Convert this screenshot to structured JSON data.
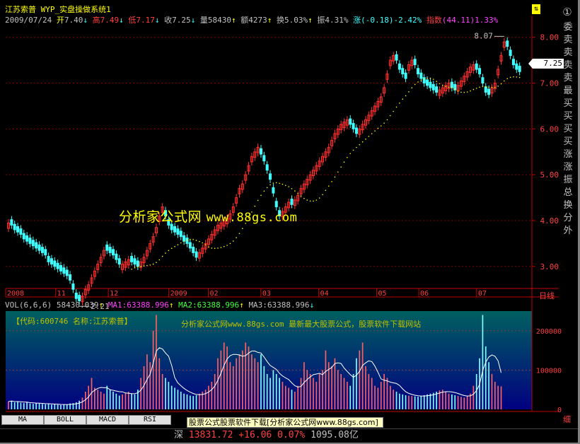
{
  "header": {
    "stock_name": "江苏索普",
    "system_name": "WYP_实盘操做系统1"
  },
  "quote": {
    "date": "2009/07/24",
    "open_label": "开",
    "open": "7.40",
    "high_label": "高",
    "high": "7.49",
    "low_label": "低",
    "low": "7.17",
    "close_label": "收",
    "close": "7.25",
    "volume_label": "量",
    "volume": "58430",
    "amount_label": "额",
    "amount": "4273",
    "turnover_label": "换",
    "turnover": "5.03%",
    "amplitude_label": "振",
    "amplitude": "4.31%",
    "change_label": "涨",
    "change": "(-0.18)-2.42%",
    "index_label": "指数",
    "index": "(44.11)1.33%"
  },
  "watermark": {
    "text": "分析家公式网",
    "url": "www.88gs.com"
  },
  "price_tag": "7.25",
  "side_menu": [
    "委",
    "卖",
    "卖",
    "卖",
    "卖",
    "最",
    "买",
    "买",
    "买",
    "买",
    "涨",
    "涨",
    "振",
    "总",
    "换",
    "分",
    "外"
  ],
  "side_top": "①",
  "nav_glyph": "⇅",
  "volume_panel": {
    "name": "VOL(6,6,6)",
    "value": "58430.039",
    "ma1_label": "MA1:",
    "ma1": "63388.996",
    "ma2_label": "MA2:",
    "ma2": "63388.996",
    "ma3_label": "MA3:",
    "ma3": "63388.996",
    "info": "【代码:600746 名称:江苏索普】",
    "promo": "分析家公式网www.88gs.com 最新最大股票公式，股票软件下载网站"
  },
  "period_label": "日线",
  "corner_label": "细",
  "tabs": [
    "MA",
    "BOLL",
    "MACD",
    "RSI"
  ],
  "promo_bar": "股票公式股票软件下载[分析家公式网www.88gs.com]",
  "status": {
    "market": "深",
    "index": "13831.72",
    "change": "+16.06",
    "pct": "0.07%",
    "turnover": "1095.08亿"
  },
  "colors": {
    "up": "#ff3030",
    "down": "#40ffff",
    "ma": "#ffff00",
    "grid": "#800000",
    "vol_bg_top": "#006060",
    "vol_bg_bottom": "#000080"
  },
  "chart_data": {
    "type": "candlestick",
    "price_axis": {
      "ticks": [
        "8.00",
        "7.00",
        "6.00",
        "5.00",
        "4.00",
        "3.00"
      ],
      "ylim": [
        2.55,
        8.35
      ]
    },
    "volume_axis": {
      "ticks": [
        "200000",
        "100000",
        "0"
      ],
      "ylim": [
        0,
        250000
      ]
    },
    "time_axis": [
      "2008",
      "11",
      "12",
      "2009",
      "02",
      "03",
      "04",
      "05",
      "06",
      "07"
    ],
    "annotations": {
      "max": "8.07",
      "min": "2.21"
    },
    "candles_close": [
      3.95,
      3.9,
      3.8,
      3.75,
      3.7,
      3.6,
      3.55,
      3.5,
      3.45,
      3.4,
      3.35,
      3.3,
      3.25,
      3.1,
      3.05,
      3.0,
      2.95,
      2.9,
      2.85,
      2.8,
      2.7,
      2.5,
      2.3,
      2.25,
      2.35,
      2.5,
      2.6,
      2.75,
      2.9,
      3.05,
      3.2,
      3.35,
      3.35,
      3.3,
      3.25,
      3.15,
      3.05,
      3.05,
      3.1,
      3.15,
      3.1,
      3.05,
      3.0,
      3.1,
      3.2,
      3.35,
      3.5,
      3.65,
      3.85,
      4.1,
      4.3,
      4.1,
      3.9,
      3.8,
      3.75,
      3.7,
      3.65,
      3.55,
      3.5,
      3.4,
      3.3,
      3.2,
      3.3,
      3.4,
      3.5,
      3.6,
      3.7,
      3.8,
      3.9,
      3.95,
      4.0,
      4.05,
      4.15,
      4.3,
      4.5,
      4.7,
      4.8,
      5.0,
      5.2,
      5.4,
      5.5,
      5.6,
      5.45,
      5.3,
      5.1,
      4.9,
      4.6,
      4.3,
      4.1,
      4.2,
      4.3,
      4.4,
      4.35,
      4.45,
      4.55,
      4.7,
      4.8,
      4.9,
      5.0,
      5.1,
      5.2,
      5.3,
      5.4,
      5.5,
      5.6,
      5.75,
      5.9,
      6.0,
      6.1,
      6.15,
      6.2,
      6.1,
      6.0,
      5.9,
      6.0,
      6.1,
      6.2,
      6.3,
      6.4,
      6.5,
      6.6,
      6.7,
      6.9,
      7.2,
      7.5,
      7.6,
      7.5,
      7.3,
      7.2,
      7.1,
      7.4,
      7.5,
      7.4,
      7.2,
      7.1,
      7.0,
      6.95,
      6.9,
      6.85,
      6.8,
      6.85,
      6.9,
      6.95,
      7.0,
      6.9,
      6.85,
      6.95,
      7.05,
      7.15,
      7.25,
      7.35,
      7.4,
      7.3,
      7.2,
      7.0,
      6.8,
      6.75,
      6.9,
      7.0,
      7.3,
      7.6,
      7.9,
      7.8,
      7.6,
      7.4,
      7.3,
      7.25
    ],
    "candles_up": [
      1,
      0,
      0,
      0,
      0,
      0,
      0,
      0,
      0,
      0,
      0,
      0,
      0,
      0,
      0,
      0,
      0,
      0,
      0,
      0,
      0,
      0,
      0,
      0,
      1,
      1,
      1,
      1,
      1,
      1,
      1,
      1,
      0,
      0,
      0,
      0,
      0,
      1,
      1,
      1,
      0,
      0,
      0,
      1,
      1,
      1,
      1,
      1,
      1,
      1,
      1,
      0,
      0,
      0,
      0,
      0,
      0,
      0,
      0,
      0,
      0,
      0,
      1,
      1,
      1,
      1,
      1,
      1,
      1,
      1,
      1,
      1,
      1,
      1,
      1,
      1,
      1,
      1,
      1,
      1,
      1,
      1,
      0,
      0,
      0,
      0,
      0,
      0,
      0,
      1,
      1,
      1,
      0,
      1,
      1,
      1,
      1,
      1,
      1,
      1,
      1,
      1,
      1,
      1,
      1,
      1,
      1,
      1,
      1,
      1,
      1,
      0,
      0,
      0,
      1,
      1,
      1,
      1,
      1,
      1,
      1,
      1,
      1,
      1,
      1,
      1,
      0,
      0,
      0,
      0,
      1,
      1,
      0,
      0,
      0,
      0,
      0,
      0,
      0,
      0,
      1,
      1,
      1,
      1,
      0,
      0,
      1,
      1,
      1,
      1,
      1,
      1,
      0,
      0,
      0,
      0,
      0,
      1,
      1,
      1,
      1,
      1,
      0,
      0,
      0,
      0,
      0
    ],
    "volumes": [
      20000,
      22000,
      18000,
      19000,
      17000,
      16000,
      18000,
      15000,
      14000,
      16000,
      15000,
      14000,
      13000,
      14000,
      12000,
      13000,
      12000,
      11000,
      12000,
      13000,
      15000,
      16000,
      18000,
      22000,
      30000,
      45000,
      60000,
      80000,
      55000,
      50000,
      45000,
      40000,
      60000,
      50000,
      45000,
      40000,
      35000,
      38000,
      42000,
      45000,
      40000,
      38000,
      50000,
      80000,
      110000,
      140000,
      120000,
      200000,
      240000,
      130000,
      90000,
      80000,
      70000,
      60000,
      55000,
      50000,
      45000,
      40000,
      38000,
      35000,
      34000,
      36000,
      40000,
      45000,
      50000,
      60000,
      70000,
      90000,
      130000,
      150000,
      170000,
      160000,
      120000,
      110000,
      130000,
      140000,
      150000,
      170000,
      160000,
      140000,
      130000,
      120000,
      140000,
      110000,
      90000,
      80000,
      100000,
      90000,
      80000,
      70000,
      60000,
      55000,
      50000,
      45000,
      60000,
      80000,
      120000,
      100000,
      90000,
      80000,
      70000,
      90000,
      100000,
      150000,
      120000,
      110000,
      130000,
      100000,
      90000,
      80000,
      70000,
      60000,
      90000,
      130000,
      150000,
      170000,
      110000,
      90000,
      80000,
      60000,
      55000,
      70000,
      90000,
      80000,
      60000,
      50000,
      45000,
      40000,
      38000,
      36000,
      35000,
      34000,
      33000,
      32000,
      34000,
      36000,
      38000,
      40000,
      42000,
      45000,
      48000,
      50000,
      45000,
      40000,
      38000,
      36000,
      34000,
      32000,
      30000,
      34000,
      40000,
      60000,
      90000,
      130000,
      240000,
      160000,
      120000,
      90000,
      70000,
      60000,
      58430
    ]
  }
}
